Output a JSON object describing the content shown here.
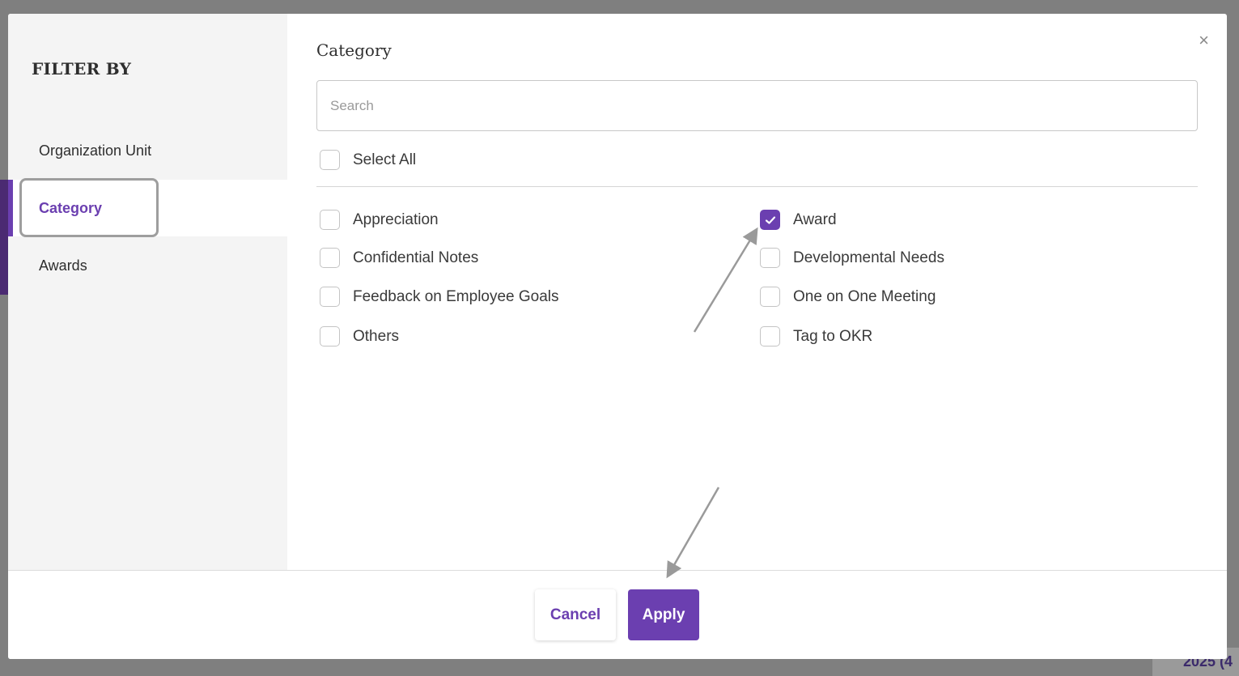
{
  "background": {
    "fragment_year": "2025 (4"
  },
  "modal": {
    "sidebar": {
      "title": "FILTER BY",
      "items": [
        {
          "label": "Organization Unit",
          "active": false
        },
        {
          "label": "Category",
          "active": true
        },
        {
          "label": "Awards",
          "active": false
        }
      ]
    },
    "content": {
      "title": "Category",
      "close_glyph": "×",
      "search": {
        "placeholder": "Search",
        "value": ""
      },
      "select_all": {
        "label": "Select All",
        "checked": false
      },
      "options_left": [
        {
          "label": "Appreciation",
          "checked": false
        },
        {
          "label": "Confidential Notes",
          "checked": false
        },
        {
          "label": "Feedback on Employee Goals",
          "checked": false
        },
        {
          "label": "Others",
          "checked": false
        }
      ],
      "options_right": [
        {
          "label": "Award",
          "checked": true
        },
        {
          "label": "Developmental Needs",
          "checked": false
        },
        {
          "label": "One on One Meeting",
          "checked": false
        },
        {
          "label": "Tag to OKR",
          "checked": false
        }
      ]
    },
    "footer": {
      "cancel_label": "Cancel",
      "apply_label": "Apply"
    }
  },
  "colors": {
    "accent": "#6b3fb0",
    "overlay": "#7f7f7f",
    "annotation_arrow": "#9a9a9a"
  },
  "icons": {
    "close": "close-icon",
    "check": "checkmark-icon"
  }
}
